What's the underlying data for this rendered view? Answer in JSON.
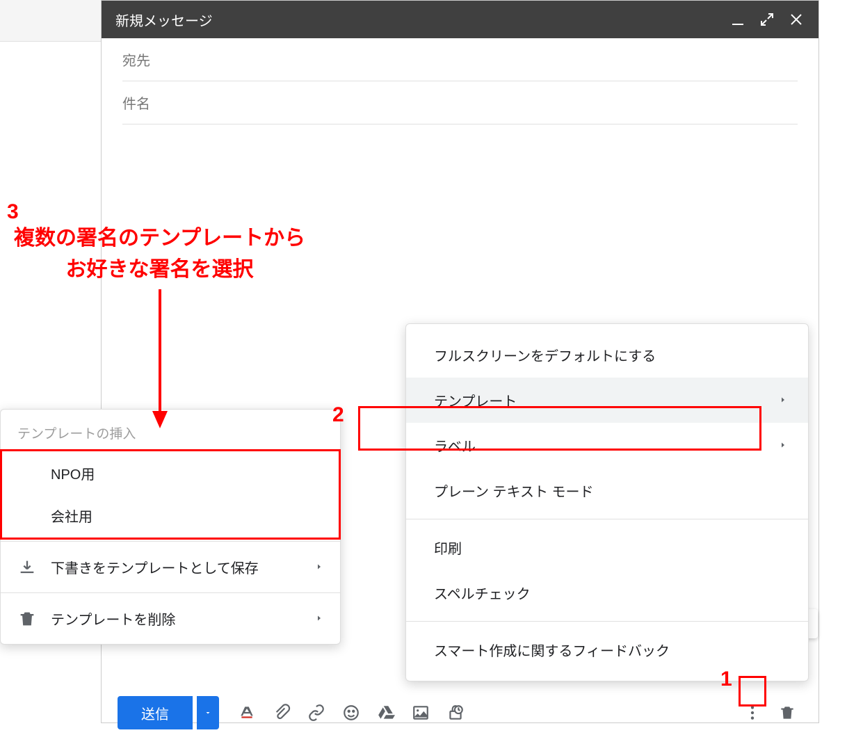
{
  "header": {
    "title": "新規メッセージ"
  },
  "fields": {
    "to": "宛先",
    "subject": "件名"
  },
  "footer": {
    "send": "送信"
  },
  "more_menu": {
    "fullscreen": "フルスクリーンをデフォルトにする",
    "template": "テンプレート",
    "label": "ラベル",
    "plaintext": "プレーン テキスト モード",
    "print": "印刷",
    "spellcheck": "スペルチェック",
    "smartcompose": "スマート作成に関するフィードバック"
  },
  "submenu": {
    "insert_title": "テンプレートの挿入",
    "items": [
      "NPO用",
      "会社用"
    ],
    "save_as": "下書きをテンプレートとして保存",
    "delete": "テンプレートを削除"
  },
  "annotations": {
    "n1": "1",
    "n2": "2",
    "n3": "3",
    "text_line1": "複数の署名のテンプレートから",
    "text_line2": "お好きな署名を選択"
  }
}
